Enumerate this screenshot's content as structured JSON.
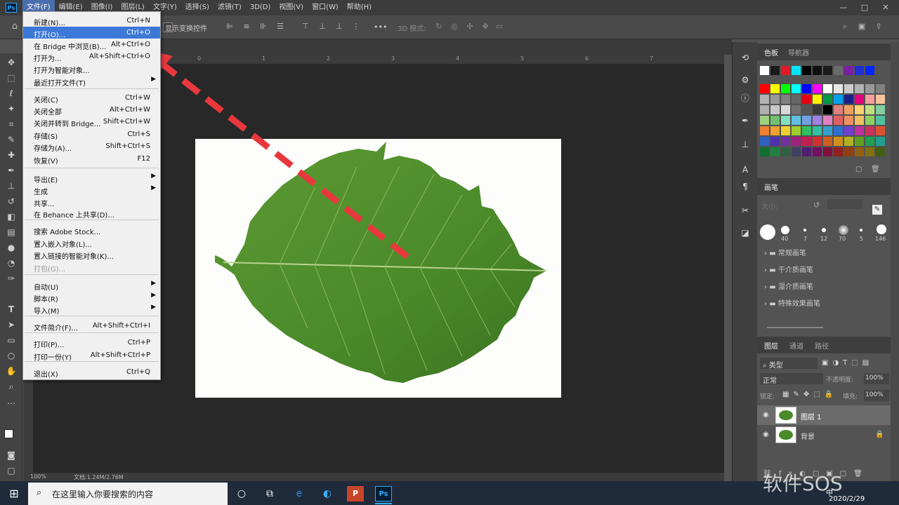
{
  "menubar": {
    "logo": "Ps",
    "items": [
      "文件(F)",
      "编辑(E)",
      "图像(I)",
      "图层(L)",
      "文字(Y)",
      "选择(S)",
      "滤镜(T)",
      "3D(D)",
      "视图(V)",
      "窗口(W)",
      "帮助(H)"
    ],
    "window_controls": [
      "—",
      "□",
      "✕"
    ]
  },
  "options_bar": {
    "show_transform_controls": "显示变换控件",
    "mode_3d": "3D 模式:",
    "more": "•••"
  },
  "file_menu": {
    "items": [
      {
        "label": "新建(N)...",
        "shortcut": "Ctrl+N"
      },
      {
        "label": "打开(O)...",
        "shortcut": "Ctrl+O"
      },
      {
        "label": "在 Bridge 中浏览(B)...",
        "shortcut": "Alt+Ctrl+O"
      },
      {
        "label": "打开为...",
        "shortcut": "Alt+Shift+Ctrl+O"
      },
      {
        "label": "打开为智能对象...",
        "shortcut": ""
      },
      {
        "label": "最近打开文件(T)",
        "shortcut": ""
      },
      {
        "label": "关闭(C)",
        "shortcut": "Ctrl+W"
      },
      {
        "label": "关闭全部",
        "shortcut": "Alt+Ctrl+W"
      },
      {
        "label": "关闭并转到 Bridge...",
        "shortcut": "Shift+Ctrl+W"
      },
      {
        "label": "存储(S)",
        "shortcut": "Ctrl+S"
      },
      {
        "label": "存储为(A)...",
        "shortcut": "Shift+Ctrl+S"
      },
      {
        "label": "恢复(V)",
        "shortcut": "F12"
      },
      {
        "label": "导出(E)",
        "shortcut": ""
      },
      {
        "label": "生成",
        "shortcut": ""
      },
      {
        "label": "共享...",
        "shortcut": ""
      },
      {
        "label": "在 Behance 上共享(D)...",
        "shortcut": ""
      },
      {
        "label": "搜索 Adobe Stock...",
        "shortcut": ""
      },
      {
        "label": "置入嵌入对象(L)...",
        "shortcut": ""
      },
      {
        "label": "置入链接的智能对象(K)...",
        "shortcut": ""
      },
      {
        "label": "打包(G)...",
        "shortcut": ""
      },
      {
        "label": "自动(U)",
        "shortcut": ""
      },
      {
        "label": "脚本(R)",
        "shortcut": ""
      },
      {
        "label": "导入(M)",
        "shortcut": ""
      },
      {
        "label": "文件简介(F)...",
        "shortcut": "Alt+Shift+Ctrl+I"
      },
      {
        "label": "打印(P)...",
        "shortcut": "Ctrl+P"
      },
      {
        "label": "打印一份(Y)",
        "shortcut": "Alt+Shift+Ctrl+P"
      },
      {
        "label": "退出(X)",
        "shortcut": "Ctrl+Q"
      }
    ]
  },
  "ruler": {
    "ticks": [
      "0",
      "1",
      "2",
      "3",
      "4",
      "5",
      "6",
      "7"
    ]
  },
  "status": {
    "zoom": "100%",
    "doc": "文档:1.24M/2.76M"
  },
  "swatches_panel": {
    "tab1": "色板",
    "tab2": "导航器"
  },
  "brush_panel": {
    "tab": "画笔",
    "size_label": "大小:",
    "sizes": [
      "40",
      "7",
      "12",
      "70",
      "5",
      "146"
    ],
    "groups": [
      "常规画笔",
      "干介质画笔",
      "湿介质画笔",
      "特殊效果画笔"
    ]
  },
  "layers_panel": {
    "tabs": [
      "图层",
      "通道",
      "路径"
    ],
    "filter": "类型",
    "blend_mode": "正常",
    "opacity_label": "不透明度:",
    "opacity": "100%",
    "lock_label": "锁定:",
    "fill_label": "填充:",
    "fill": "100%",
    "layers": [
      "图层 1",
      "背景"
    ]
  },
  "taskbar": {
    "search_placeholder": "在这里输入你要搜索的内容",
    "ime": "中",
    "date": "2020/2/29"
  },
  "watermark": "软件SOS",
  "colors": {
    "menu_highlight": "#3c78d8",
    "arrow": "#e8383d",
    "leaf": "#4a8a2a"
  }
}
